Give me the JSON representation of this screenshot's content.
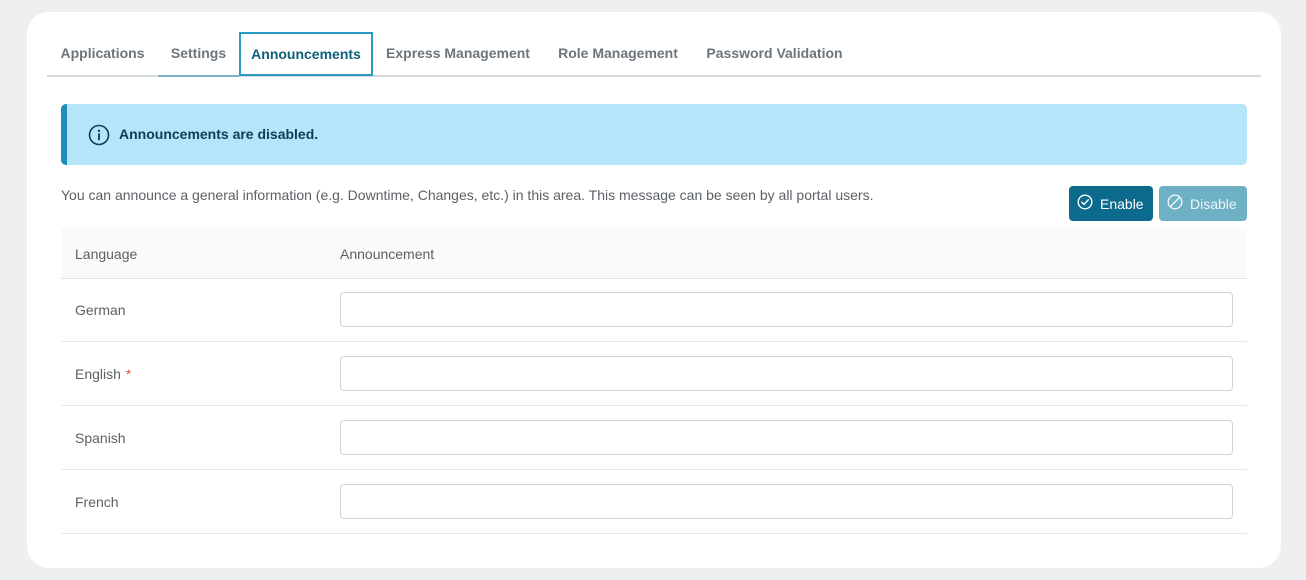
{
  "tabs": [
    {
      "label": "Applications"
    },
    {
      "label": "Settings"
    },
    {
      "label": "Announcements"
    },
    {
      "label": "Express Management"
    },
    {
      "label": "Role Management"
    },
    {
      "label": "Password Validation"
    }
  ],
  "active_tab": "Announcements",
  "alert": {
    "icon": "info-icon",
    "message": "Announcements are disabled."
  },
  "description": "You can announce a general information (e.g. Downtime, Changes, etc.) in this area. This message can be seen by all portal users.",
  "buttons": {
    "enable": {
      "label": "Enable",
      "icon": "check-circle-icon"
    },
    "disable": {
      "label": "Disable",
      "icon": "ban-circle-icon"
    }
  },
  "table": {
    "headers": {
      "language": "Language",
      "announcement": "Announcement"
    },
    "rows": [
      {
        "language": "German",
        "required": false,
        "value": ""
      },
      {
        "language": "English",
        "required": true,
        "required_marker": "*",
        "value": ""
      },
      {
        "language": "Spanish",
        "required": false,
        "value": ""
      },
      {
        "language": "French",
        "required": false,
        "value": ""
      }
    ]
  },
  "colors": {
    "accent": "#0c6b8c",
    "alert_bg": "#b6e5f9",
    "active_tab_border": "#2a9cc2"
  }
}
